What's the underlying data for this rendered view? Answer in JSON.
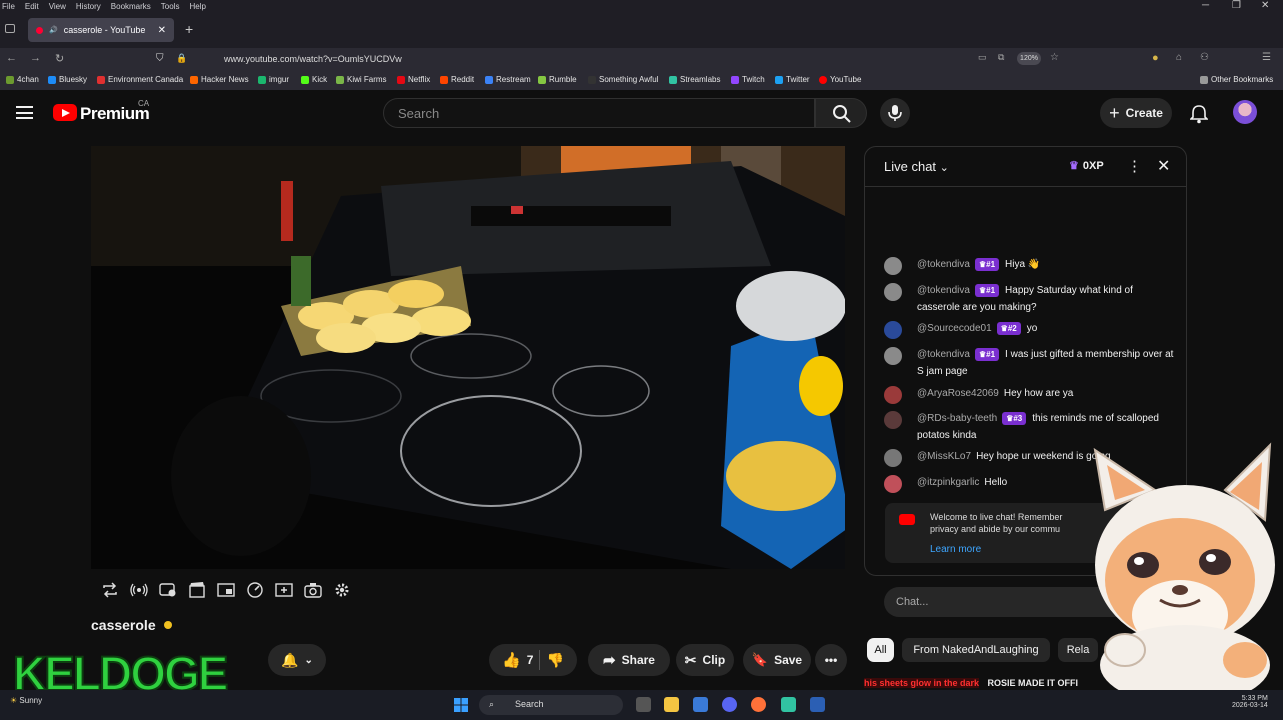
{
  "browser": {
    "menu": [
      "File",
      "Edit",
      "View",
      "History",
      "Bookmarks",
      "Tools",
      "Help"
    ],
    "tab_title": "casserole - YouTube",
    "url": "www.youtube.com/watch?v=OumlsYUCDVw",
    "zoom": "120%",
    "bookmarks": [
      "4chan",
      "Bluesky",
      "Environment Canada",
      "Hacker News",
      "imgur",
      "Kick",
      "Kiwi Farms",
      "Netflix",
      "Reddit",
      "Restream",
      "Rumble",
      "Something Awful",
      "Streamlabs",
      "Twitch",
      "Twitter",
      "YouTube"
    ],
    "other_bookmarks": "Other Bookmarks"
  },
  "header": {
    "logo": "Premium",
    "region": "CA",
    "search_placeholder": "Search",
    "create_label": "Create"
  },
  "video": {
    "title": "casserole",
    "overlay_logo_text": "KELDOGE",
    "like_count": "7",
    "share_label": "Share",
    "clip_label": "Clip",
    "save_label": "Save"
  },
  "chat": {
    "title": "Live chat",
    "xp": "0XP",
    "messages": [
      {
        "user": "@tokendiva",
        "badge": "#1",
        "text": "Hiya 👋"
      },
      {
        "user": "@tokendiva",
        "badge": "#1",
        "text": "Happy Saturday what kind of casserole are you making?"
      },
      {
        "user": "@Sourcecode01",
        "badge": "#2",
        "text": "yo"
      },
      {
        "user": "@tokendiva",
        "badge": "#1",
        "text": "I was just gifted a membership over at S jam page"
      },
      {
        "user": "@AryaRose42069",
        "badge": "",
        "text": "Hey how are ya"
      },
      {
        "user": "@RDs-baby-teeth",
        "badge": "#3",
        "text": "this reminds me of scalloped potatos kinda"
      },
      {
        "user": "@MissKLo7",
        "badge": "",
        "text": "Hey hope ur weekend is going"
      },
      {
        "user": "@itzpinkgarlic",
        "badge": "",
        "text": "Hello"
      }
    ],
    "welcome_text": "Welcome to live chat! Remember",
    "welcome_text2": "privacy and abide by our commu",
    "learn_more": "Learn more",
    "input_placeholder": "Chat..."
  },
  "chips": [
    "All",
    "From NakedAndLaughing",
    "Rela"
  ],
  "ticker": {
    "red": "his sheets glow in the dark",
    "white": "ROSIE MADE IT OFFI"
  },
  "taskbar": {
    "search": "Search",
    "weather": "Sunny",
    "time": "5:33 PM",
    "date": "2026-03-14"
  },
  "colors": {
    "yt_red": "#ff0000",
    "badge_purple": "#7a2fd0",
    "overlay_green": "#2fd13f"
  }
}
